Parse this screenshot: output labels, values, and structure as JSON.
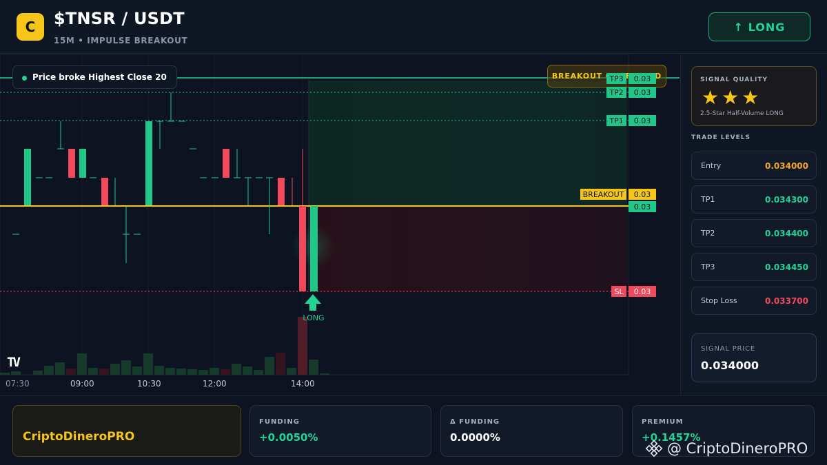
{
  "header": {
    "logo_letter": "C",
    "pair": "$TNSR / USDT",
    "subtitle": "15M • IMPULSE BREAKOUT",
    "direction_label": "↑ LONG"
  },
  "chart": {
    "status": "Price broke Highest Close 20",
    "banner": "BREAKOUT CONFIRMED",
    "signal_marker": "LONG",
    "tv_logo": "TV",
    "time_labels": [
      "07:30",
      "09:00",
      "10:30",
      "12:00",
      "14:00"
    ],
    "level_tags": {
      "tp3": {
        "name": "TP3",
        "value": "0.03"
      },
      "tp2": {
        "name": "TP2",
        "value": "0.03"
      },
      "tp1": {
        "name": "TP1",
        "value": "0.03"
      },
      "breakout": {
        "name": "BREAKOUT",
        "value": "0.03"
      },
      "entry": {
        "value": "0.03"
      },
      "sl": {
        "name": "SL",
        "value": "0.03"
      }
    },
    "colors": {
      "up": "#1fc888",
      "down": "#f0495c",
      "breakout": "#f5c518",
      "entry": "#22d394"
    }
  },
  "panel": {
    "quality_title": "SIGNAL QUALITY",
    "stars": "★★★",
    "quality_desc": "2.5-Star Half-Volume LONG",
    "levels_title": "TRADE LEVELS",
    "levels": [
      {
        "name": "Entry",
        "value": "0.034000",
        "color": "#f5a623"
      },
      {
        "name": "TP1",
        "value": "0.034300",
        "color": "#22d394"
      },
      {
        "name": "TP2",
        "value": "0.034400",
        "color": "#22d394"
      },
      {
        "name": "TP3",
        "value": "0.034450",
        "color": "#22d394"
      },
      {
        "name": "Stop Loss",
        "value": "0.033700",
        "color": "#f0495c"
      }
    ],
    "signal_price_title": "SIGNAL PRICE",
    "signal_price": "0.034000"
  },
  "footer": {
    "brand": "CriptoDineroPRO",
    "stats": [
      {
        "title": "FUNDING",
        "value": "+0.0050%",
        "color": "#22d394"
      },
      {
        "title": "Δ FUNDING",
        "value": "0.0000%",
        "color": "#ffffff"
      },
      {
        "title": "PREMIUM",
        "value": "+0.1457%",
        "color": "#22d394"
      }
    ],
    "watermark": "@ CriptoDineroPRO"
  }
}
